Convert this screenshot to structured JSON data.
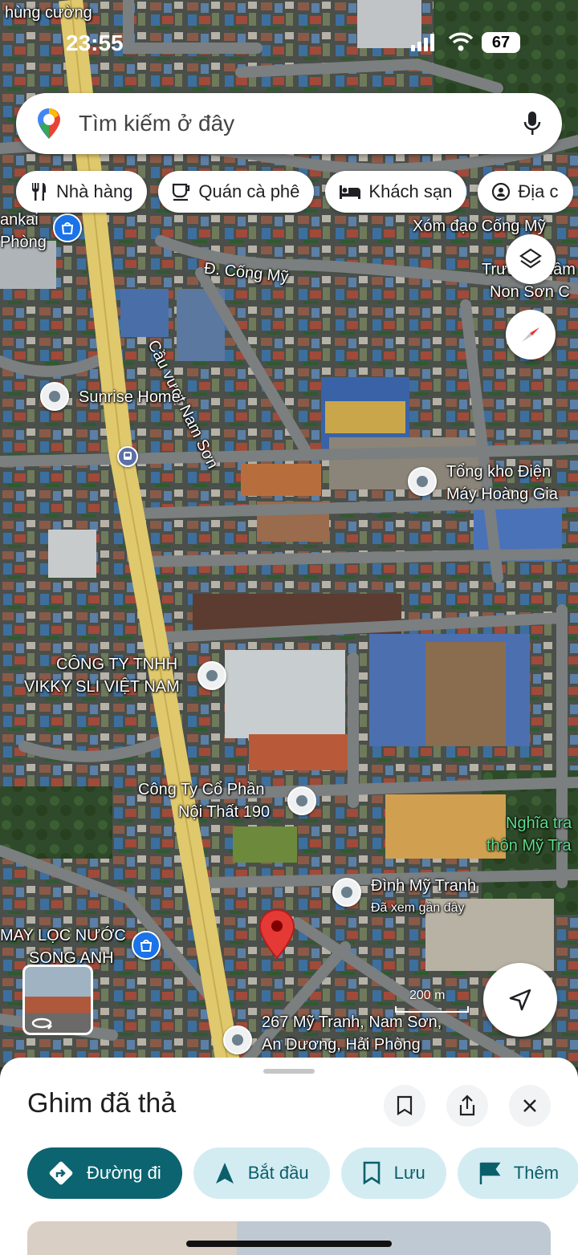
{
  "status_bar": {
    "time": "23:55",
    "battery": "67"
  },
  "search": {
    "placeholder": "Tìm kiếm ở đây"
  },
  "chips": [
    {
      "label": "Nhà hàng",
      "icon": "fork-knife-icon"
    },
    {
      "label": "Quán cà phê",
      "icon": "coffee-cup-icon"
    },
    {
      "label": "Khách sạn",
      "icon": "bed-icon"
    },
    {
      "label": "Địa c",
      "icon": "landmark-icon"
    }
  ],
  "map": {
    "labels": {
      "hung_cuong": "hùng cường",
      "ankai": "ankai",
      "phong": "Phòng",
      "xom_dao": "Xóm đạo Cống Mỹ",
      "truong": "Trường Mầm",
      "non_son": "Non Sơn C",
      "duong_cong_my": "Đ. Cống Mỹ",
      "cau_vuot": "Cầu vượt Nam Sơn",
      "sunrise": "Sunrise Home",
      "tong_kho_1": "Tổng kho Điện",
      "tong_kho_2": "Máy Hoàng Gia",
      "vikky_1": "CÔNG TY TNHH",
      "vikky_2": "VIKKY SLI VIỆT NAM",
      "noi_that_1": "Công Ty Cổ Phần",
      "noi_that_2": "Nội Thất 190",
      "nghia_trang_1": "Nghĩa tra",
      "nghia_trang_2": "thôn Mỹ Tra",
      "dinh_my_tranh": "Đình Mỹ Tranh",
      "da_xem": "Đã xem gần đây",
      "loc_nuoc_1": "MAY LỌC NƯỚC",
      "loc_nuoc_2": "SONG ANH",
      "address_1": "267 Mỹ Tranh, Nam Sơn,",
      "address_2": "An Dương, Hải Phòng",
      "scale": "200 m"
    },
    "pin_color": "#e53935"
  },
  "sheet": {
    "title": "Ghim đã thả",
    "actions": [
      {
        "label": "Đường đi",
        "icon": "directions-icon"
      },
      {
        "label": "Bắt đầu",
        "icon": "navigation-arrow-icon"
      },
      {
        "label": "Lưu",
        "icon": "bookmark-icon"
      },
      {
        "label": "Thêm",
        "icon": "flag-icon"
      }
    ]
  },
  "colors": {
    "primary": "#0b6470",
    "chip_bg": "#d3ecf2",
    "road": "#e0c96c"
  }
}
